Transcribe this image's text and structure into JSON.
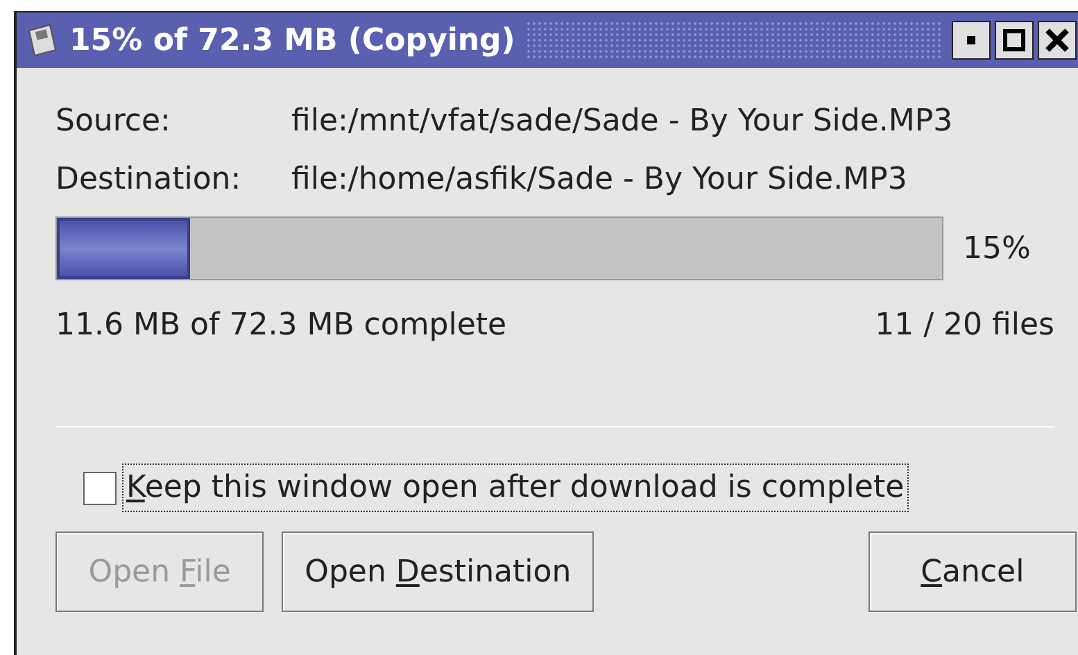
{
  "window": {
    "title": "15% of 72.3 MB  (Copying)"
  },
  "fields": [
    {
      "label": "Source:",
      "value": "file:/mnt/vfat/sade/Sade - By Your Side.MP3"
    },
    {
      "label": "Destination:",
      "value": "file:/home/asfik/Sade - By Your Side.MP3"
    }
  ],
  "progress": {
    "level": 0.15,
    "reading": "15%"
  },
  "status": {
    "size": "11.6 MB of 72.3 MB complete",
    "files": "11 / 20 files"
  },
  "keep_open": {
    "checked": false,
    "label": {
      "key": "K",
      "after": "eep this window open after download is complete"
    }
  },
  "buttons": [
    {
      "label": {
        "before": "Open ",
        "key": "F",
        "after": "ile"
      },
      "disabled": true
    },
    {
      "label": {
        "before": "Open ",
        "key": "D",
        "after": "estination"
      },
      "disabled": false
    },
    {
      "label": {
        "key": "C",
        "after": "ancel"
      },
      "disabled": false
    }
  ]
}
